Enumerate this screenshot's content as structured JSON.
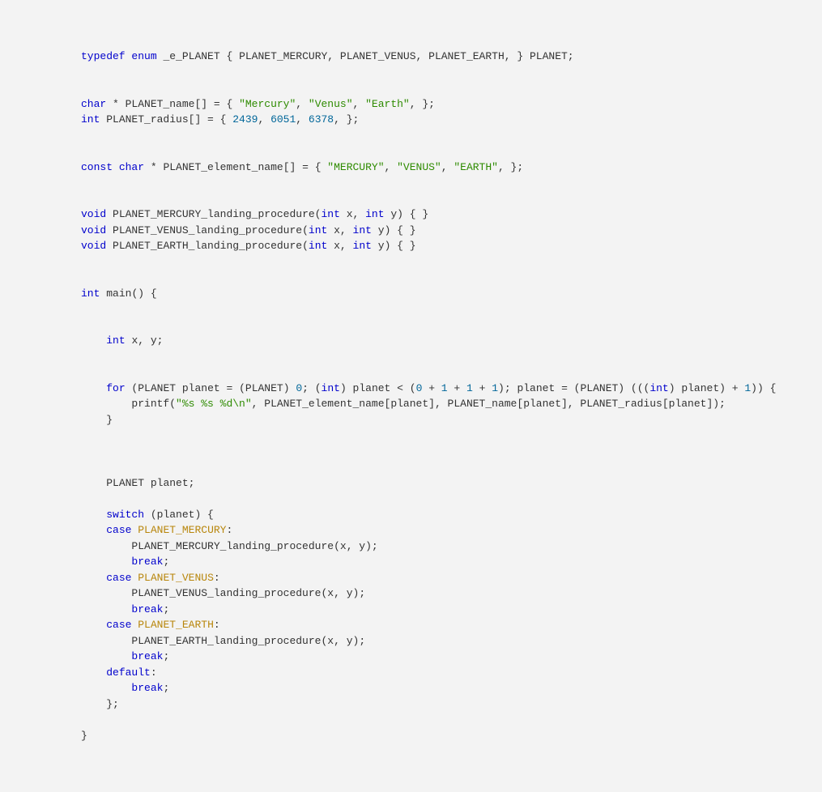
{
  "tokens": {
    "kw_typedef": "typedef",
    "kw_enum": "enum",
    "kw_char": "char",
    "kw_int": "int",
    "kw_const": "const",
    "kw_void": "void",
    "kw_for": "for",
    "kw_switch": "switch",
    "kw_case": "case",
    "kw_break": "break",
    "kw_default": "default",
    "id_ePLANET": "_e_PLANET",
    "id_PLANET": "PLANET",
    "id_PLANET_MERCURY": "PLANET_MERCURY",
    "id_PLANET_VENUS": "PLANET_VENUS",
    "id_PLANET_EARTH": "PLANET_EARTH",
    "id_PLANET_name": "PLANET_name",
    "id_PLANET_radius": "PLANET_radius",
    "id_PLANET_element_name": "PLANET_element_name",
    "id_main": "main",
    "id_x": "x",
    "id_y": "y",
    "id_planet": "planet",
    "id_printf": "printf",
    "fn_merc": "PLANET_MERCURY_landing_procedure",
    "fn_venus": "PLANET_VENUS_landing_procedure",
    "fn_earth": "PLANET_EARTH_landing_procedure",
    "str_Mercury": "\"Mercury\"",
    "str_Venus": "\"Venus\"",
    "str_Earth": "\"Earth\"",
    "str_MERCURY": "\"MERCURY\"",
    "str_VENUS": "\"VENUS\"",
    "str_EARTH": "\"EARTH\"",
    "str_fmt": "\"%s %s %d\\n\"",
    "num_2439": "2439",
    "num_6051": "6051",
    "num_6378": "6378",
    "num_0": "0",
    "num_1": "1"
  }
}
